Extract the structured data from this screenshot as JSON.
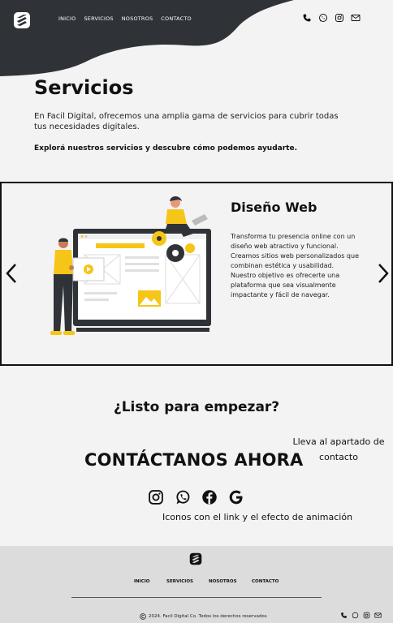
{
  "header": {
    "nav": [
      "INICIO",
      "SERVICIOS",
      "NOSOTROS",
      "CONTACTO"
    ],
    "social_icons": [
      "phone-icon",
      "whatsapp-icon",
      "instagram-icon",
      "mail-icon"
    ]
  },
  "intro": {
    "title": "Servicios",
    "description": "En Facil Digital, ofrecemos una amplia gama de servicios para cubrir todas tus necesidades digitales.",
    "explore": "Explorá nuestros servicios y descubre cómo podemos ayudarte."
  },
  "carousel": {
    "service_title": "Diseño Web",
    "service_description": "Transforma tu presencia online con un diseño web atractivo y funcional.\nCreamos sitios web personalizados que combinan estética y usabilidad. Nuestro objetivo es ofrecerte una plataforma que sea visualmente impactante y fácil de navegar."
  },
  "cta": {
    "ready": "¿Listo para empezar?",
    "contact_now": "CONTÁCTANOS AHORA",
    "note_link": "Lleva al apartado de contacto",
    "note_icons": "Iconos con el link y el efecto de animación",
    "social_icons": [
      "instagram-icon",
      "whatsapp-icon",
      "facebook-icon",
      "google-icon"
    ]
  },
  "footer": {
    "nav": [
      "INICIO",
      "SERVICIOS",
      "NOSOTROS",
      "CONTACTO"
    ],
    "copyright": "2024. Facil Digital Co. Todos los derechos reservados",
    "social_icons": [
      "phone-icon",
      "whatsapp-icon",
      "instagram-icon",
      "mail-icon"
    ]
  },
  "colors": {
    "dark": "#2f3338",
    "accent": "#f5c518",
    "background": "#f3f3f3",
    "footer_bg": "#dcdcdc"
  }
}
